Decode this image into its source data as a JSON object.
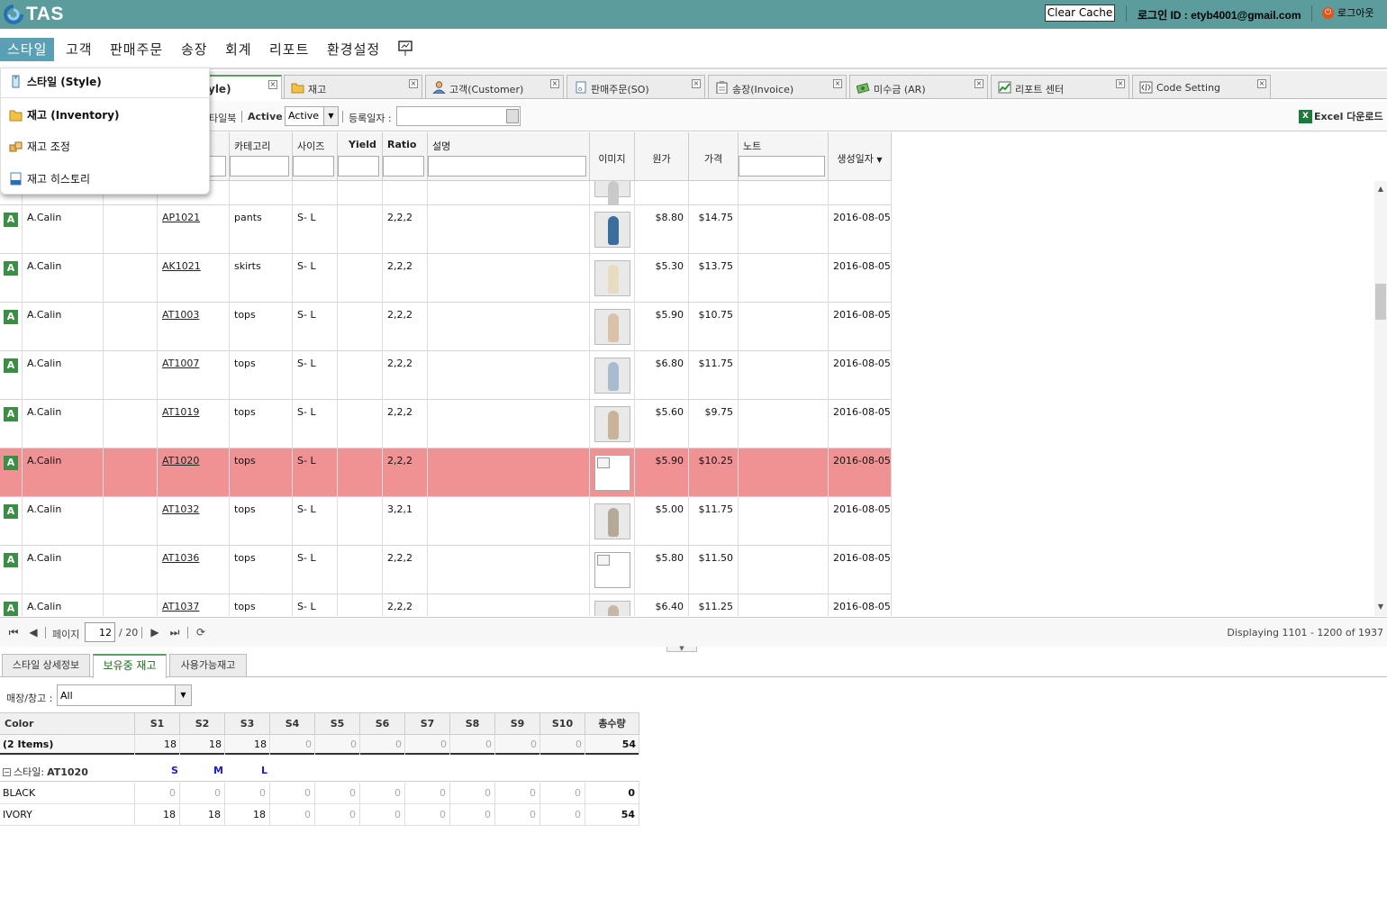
{
  "app": {
    "logo_text": "TAS",
    "clear_cache": "Clear Cache",
    "login_id": "로그인 ID : etyb4001@gmail.com",
    "logout": "로그아웃"
  },
  "menu": {
    "items": [
      "스타일",
      "고객",
      "판매주문",
      "송장",
      "회계",
      "리포트",
      "환경설정"
    ]
  },
  "dropdown": {
    "items": [
      "스타일 (Style)",
      "재고 (Inventory)",
      "재고 조정",
      "재고 히스토리"
    ]
  },
  "tabs": [
    {
      "label": "yle)"
    },
    {
      "label": "재고"
    },
    {
      "label": "고객(Customer)"
    },
    {
      "label": "판매주문(SO)"
    },
    {
      "label": "송장(Invoice)"
    },
    {
      "label": "미수금 (AR)"
    },
    {
      "label": "리포트 센터"
    },
    {
      "label": "Code Setting"
    }
  ],
  "toolbar": {
    "partial_label": "타일북",
    "active_label": "Active :",
    "active_value": "Active",
    "date_label": "등록일자 :",
    "excel": "Excel 다운로드"
  },
  "grid": {
    "headers": [
      "카테고리",
      "사이즈",
      "Yield",
      "Ratio",
      "설명",
      "이미지",
      "원가",
      "가격",
      "노트",
      "생성일자"
    ],
    "rows": [
      {
        "status": "A",
        "vendor": "A.Calin",
        "style": "AP1021",
        "category": "pants",
        "size": "S- L",
        "ratio": "2,2,2",
        "cost": "$8.80",
        "price": "$14.75",
        "date": "2016-08-05",
        "image": "photo",
        "color": "#3a6e9e"
      },
      {
        "status": "A",
        "vendor": "A.Calin",
        "style": "AK1021",
        "category": "skirts",
        "size": "S- L",
        "ratio": "2,2,2",
        "cost": "$5.30",
        "price": "$13.75",
        "date": "2016-08-05",
        "image": "photo",
        "color": "#e8dcc0"
      },
      {
        "status": "A",
        "vendor": "A.Calin",
        "style": "AT1003",
        "category": "tops",
        "size": "S- L",
        "ratio": "2,2,2",
        "cost": "$5.90",
        "price": "$10.75",
        "date": "2016-08-05",
        "image": "photo",
        "color": "#d9c2a8"
      },
      {
        "status": "A",
        "vendor": "A.Calin",
        "style": "AT1007",
        "category": "tops",
        "size": "S- L",
        "ratio": "2,2,2",
        "cost": "$6.80",
        "price": "$11.75",
        "date": "2016-08-05",
        "image": "photo",
        "color": "#a8bccf"
      },
      {
        "status": "A",
        "vendor": "A.Calin",
        "style": "AT1019",
        "category": "tops",
        "size": "S- L",
        "ratio": "2,2,2",
        "cost": "$5.60",
        "price": "$9.75",
        "date": "2016-08-05",
        "image": "photo",
        "color": "#c9b49a"
      },
      {
        "status": "A",
        "vendor": "A.Calin",
        "style": "AT1020",
        "category": "tops",
        "size": "S- L",
        "ratio": "2,2,2",
        "cost": "$5.90",
        "price": "$10.25",
        "date": "2016-08-05",
        "image": "broken",
        "color": "#ffffff",
        "selected": true
      },
      {
        "status": "A",
        "vendor": "A.Calin",
        "style": "AT1032",
        "category": "tops",
        "size": "S- L",
        "ratio": "3,2,1",
        "cost": "$5.00",
        "price": "$11.75",
        "date": "2016-08-05",
        "image": "photo",
        "color": "#b5a99a"
      },
      {
        "status": "A",
        "vendor": "A.Calin",
        "style": "AT1036",
        "category": "tops",
        "size": "S- L",
        "ratio": "2,2,2",
        "cost": "$5.80",
        "price": "$11.50",
        "date": "2016-08-05",
        "image": "broken",
        "color": "#ffffff"
      },
      {
        "status": "A",
        "vendor": "A.Calin",
        "style": "AT1037",
        "category": "tops",
        "size": "S- L",
        "ratio": "2,2,2",
        "cost": "$6.40",
        "price": "$11.25",
        "date": "2016-08-05",
        "image": "photo",
        "color": "#c6b8a6"
      }
    ]
  },
  "pager": {
    "page_label": "페이지",
    "page": "12",
    "total": "/ 20",
    "display": "Displaying 1101 - 1200 of 1937"
  },
  "bottom_tabs": [
    "스타일 상세정보",
    "보유중 재고",
    "사용가능재고"
  ],
  "store": {
    "label": "매장/창고 :",
    "value": "All"
  },
  "inventory": {
    "headers": [
      "Color",
      "S1",
      "S2",
      "S3",
      "S4",
      "S5",
      "S6",
      "S7",
      "S8",
      "S9",
      "S10",
      "총수량"
    ],
    "summary": [
      "(2 Items)",
      "18",
      "18",
      "18",
      "0",
      "0",
      "0",
      "0",
      "0",
      "0",
      "0",
      "54"
    ],
    "group": {
      "prefix": "스타일:",
      "style": "AT1020",
      "sizes": [
        "S",
        "M",
        "L"
      ]
    },
    "rows": [
      [
        "BLACK",
        "0",
        "0",
        "0",
        "0",
        "0",
        "0",
        "0",
        "0",
        "0",
        "0",
        "0"
      ],
      [
        "IVORY",
        "18",
        "18",
        "18",
        "0",
        "0",
        "0",
        "0",
        "0",
        "0",
        "0",
        "54"
      ]
    ]
  },
  "colors": {
    "topbar": "#5c9c9c",
    "menu_active": "#5aa0b5",
    "selected_row": "#f09294",
    "status_badge": "#3c8e46"
  }
}
